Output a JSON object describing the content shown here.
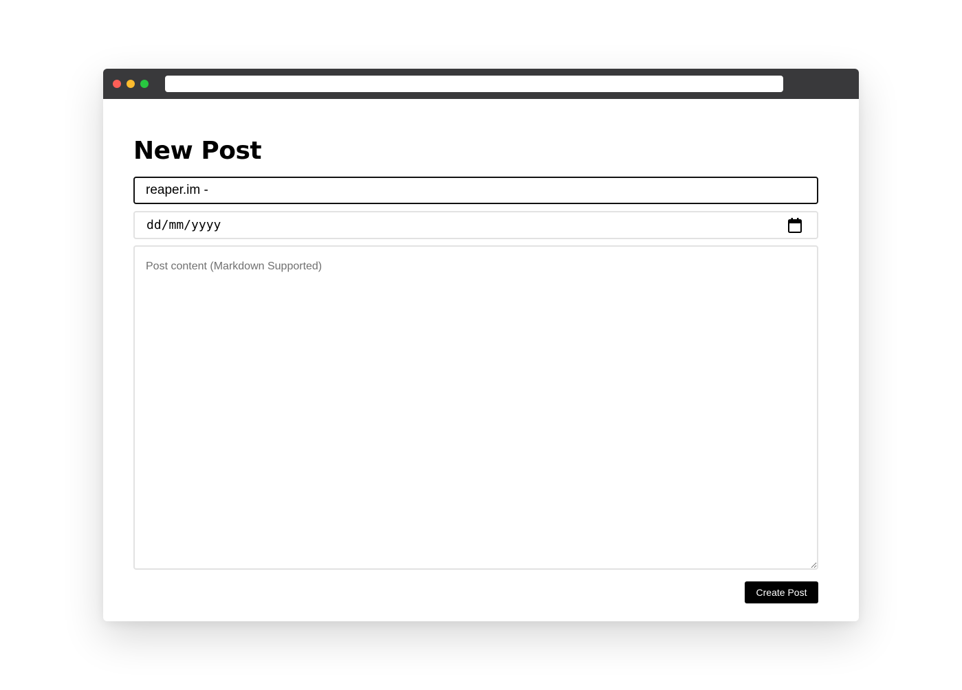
{
  "browser": {
    "url": ""
  },
  "page": {
    "title": "New Post"
  },
  "form": {
    "title_value": "reaper.im - ",
    "date_placeholder": "dd/mm/yyyy",
    "content_placeholder": "Post content (Markdown Supported)",
    "content_value": "",
    "submit_label": "Create Post"
  },
  "icons": {
    "date": "calendar-icon"
  },
  "colors": {
    "titlebar": "#39393b",
    "close": "#fe5f57",
    "minimize": "#febc2e",
    "maximize": "#28c840",
    "button": "#000000"
  }
}
